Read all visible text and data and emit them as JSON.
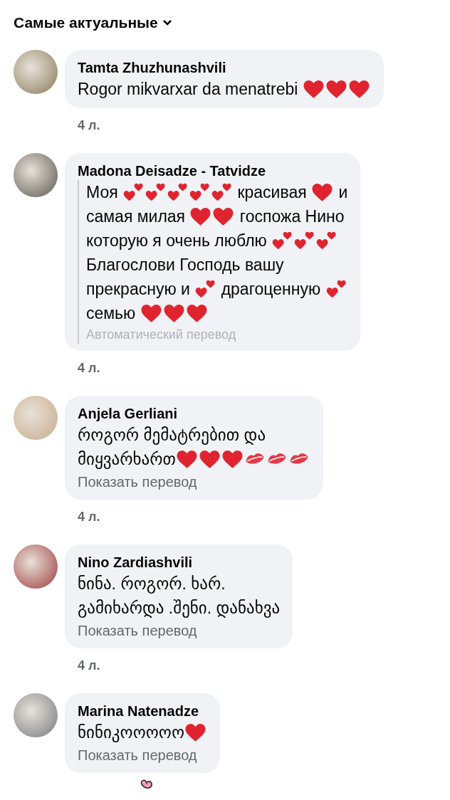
{
  "sort_menu": {
    "label": "Самые актуальные"
  },
  "comments": [
    {
      "author": "Tamta Zhuzhunashvili",
      "lines": [
        [
          {
            "kind": "text",
            "text": "Rogor mikvarxar da menatrebi "
          },
          {
            "kind": "heart"
          },
          {
            "kind": "heart"
          },
          {
            "kind": "heart"
          }
        ]
      ],
      "time": "4 л."
    },
    {
      "author": "Madona Deisadze - Tatvidze",
      "lines": [
        [
          {
            "kind": "text",
            "text": "Моя "
          },
          {
            "kind": "two-hearts"
          },
          {
            "kind": "two-hearts"
          },
          {
            "kind": "two-hearts"
          },
          {
            "kind": "two-hearts"
          },
          {
            "kind": "two-hearts"
          },
          {
            "kind": "text",
            "text": " красивая "
          },
          {
            "kind": "heart"
          },
          {
            "kind": "text",
            "text": " и"
          }
        ],
        [
          {
            "kind": "text",
            "text": "самая милая "
          },
          {
            "kind": "heart"
          },
          {
            "kind": "heart"
          },
          {
            "kind": "text",
            "text": " госпожа Нино"
          }
        ],
        [
          {
            "kind": "text",
            "text": "которую я очень люблю "
          },
          {
            "kind": "two-hearts"
          },
          {
            "kind": "two-hearts"
          },
          {
            "kind": "two-hearts"
          }
        ],
        [
          {
            "kind": "text",
            "text": "Благослови Господь вашу"
          }
        ],
        [
          {
            "kind": "text",
            "text": "прекрасную и "
          },
          {
            "kind": "two-hearts"
          },
          {
            "kind": "text",
            "text": " драгоценную "
          },
          {
            "kind": "two-hearts"
          }
        ],
        [
          {
            "kind": "text",
            "text": "семью "
          },
          {
            "kind": "heart"
          },
          {
            "kind": "heart"
          },
          {
            "kind": "heart"
          }
        ]
      ],
      "translation": {
        "kind": "auto",
        "text": "Автоматический перевод"
      },
      "time": "4 л."
    },
    {
      "author": "Anjela Gerliani",
      "lines": [
        [
          {
            "kind": "text",
            "text": "როგორ მემატრებით და"
          }
        ],
        [
          {
            "kind": "text",
            "text": "მიყვარხართ"
          },
          {
            "kind": "heart"
          },
          {
            "kind": "heart"
          },
          {
            "kind": "heart"
          },
          {
            "kind": "kiss"
          },
          {
            "kind": "kiss"
          },
          {
            "kind": "kiss"
          }
        ]
      ],
      "translation": {
        "kind": "link",
        "text": "Показать перевод"
      },
      "time": "4 л."
    },
    {
      "author": "Nino Zardiashvili",
      "lines": [
        [
          {
            "kind": "text",
            "text": "ნინა. როგორ. ხარ."
          }
        ],
        [
          {
            "kind": "text",
            "text": "გამიხარდა .შენი. დანახვა"
          }
        ]
      ],
      "translation": {
        "kind": "link",
        "text": "Показать перевод"
      },
      "time": "4 л."
    },
    {
      "author": "Marina Natenadze",
      "lines": [
        [
          {
            "kind": "text",
            "text": "ნინიკოოოოო"
          },
          {
            "kind": "heart"
          }
        ]
      ],
      "translation": {
        "kind": "link",
        "text": "Показать перевод"
      }
    }
  ]
}
